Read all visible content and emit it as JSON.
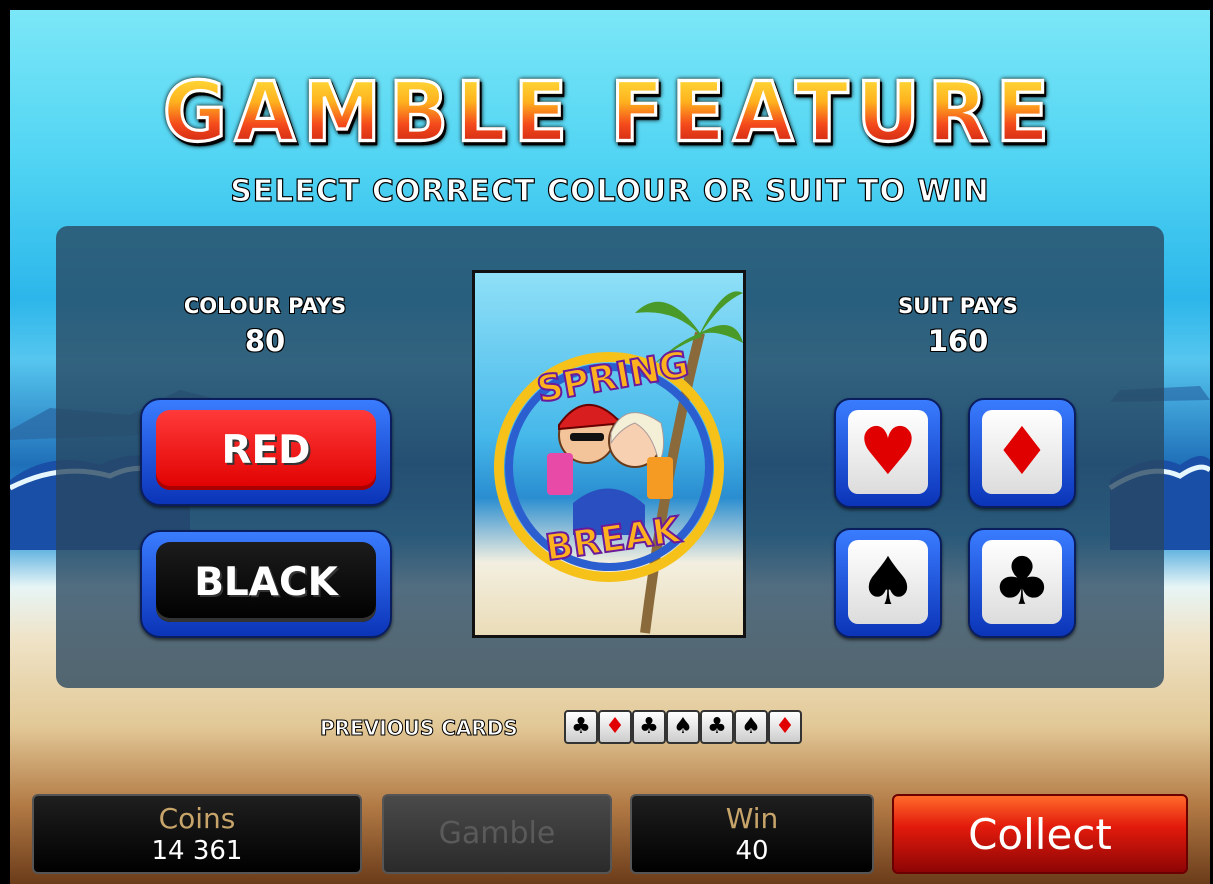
{
  "header": {
    "title": "GAMBLE FEATURE",
    "subtitle": "SELECT CORRECT COLOUR OR SUIT TO WIN"
  },
  "colour_pays": {
    "label": "COLOUR PAYS",
    "value": "80"
  },
  "suit_pays": {
    "label": "SUIT PAYS",
    "value": "160"
  },
  "colour_buttons": {
    "red": "RED",
    "black": "BLACK"
  },
  "suit_buttons": {
    "hearts": "♥",
    "diamonds": "♦",
    "spades": "♠",
    "clubs": "♣"
  },
  "card": {
    "logo_line1": "SPRING",
    "logo_line2": "BREAK"
  },
  "previous_cards": {
    "label": "PREVIOUS CARDS",
    "cards": [
      {
        "suit": "clubs",
        "glyph": "♣",
        "color": "#000000"
      },
      {
        "suit": "diamonds",
        "glyph": "♦",
        "color": "#e00000"
      },
      {
        "suit": "clubs",
        "glyph": "♣",
        "color": "#000000"
      },
      {
        "suit": "spades",
        "glyph": "♠",
        "color": "#000000"
      },
      {
        "suit": "clubs",
        "glyph": "♣",
        "color": "#000000"
      },
      {
        "suit": "spades",
        "glyph": "♠",
        "color": "#000000"
      },
      {
        "suit": "diamonds",
        "glyph": "♦",
        "color": "#e00000"
      }
    ]
  },
  "bottom_bar": {
    "coins_label": "Coins",
    "coins_value": "14 361",
    "gamble_label": "Gamble",
    "win_label": "Win",
    "win_value": "40",
    "collect_label": "Collect"
  },
  "colors": {
    "red": "#e00000",
    "black": "#000000",
    "button_blue": "#0b34b8",
    "label_gold": "#c7a46a"
  }
}
